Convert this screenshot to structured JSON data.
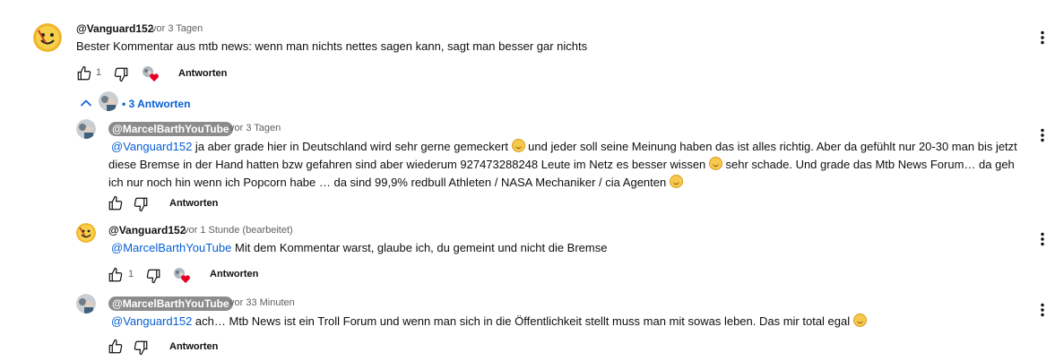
{
  "thread": {
    "main": {
      "author": "@Vanguard152",
      "time": "vor 3 Tagen",
      "text": "Bester Kommentar aus mtb news: wenn man nichts nettes sagen kann, sagt man besser gar nichts",
      "likes": "1",
      "reply_label": "Antworten"
    },
    "replies_toggle": "• 3 Antworten",
    "replies": [
      {
        "author": "@MarcelBarthYouTube",
        "time": "vor 3 Tagen",
        "mention": "@Vanguard152",
        "text_a": " ja aber grade hier in Deutschland wird sehr gerne gemeckert ",
        "text_b": " und jeder soll seine Meinung haben das ist alles richtig. Aber da gefühlt nur 20-30 man bis jetzt diese Bremse in der Hand hatten bzw gefahren sind aber wiederum 927473288248 Leute im Netz es besser wissen ",
        "text_c": " sehr schade. Und grade das Mtb News Forum… da geh ich nur noch hin wenn ich Popcorn habe … da sind 99,9% redbull Athleten / NASA Mechaniker / cia Agenten ",
        "reply_label": "Antworten"
      },
      {
        "author": "@Vanguard152",
        "time": "vor 1 Stunde (bearbeitet)",
        "mention": "@MarcelBarthYouTube",
        "text": " Mit dem Kommentar warst, glaube ich, du gemeint und nicht die Bremse",
        "likes": "1",
        "reply_label": "Antworten"
      },
      {
        "author": "@MarcelBarthYouTube",
        "time": "vor 33 Minuten",
        "mention": "@Vanguard152",
        "text": " ach… Mtb News ist ein Troll Forum und wenn man sich in die Öffentlichkeit stellt muss man mit sowas leben. Das mir total egal ",
        "reply_label": "Antworten"
      }
    ]
  },
  "colors": {
    "link": "#065fd4",
    "chip": "#8c8c8c",
    "heart": "#e60023",
    "text": "#0f0f0f",
    "muted": "#606060"
  },
  "icons": [
    "like-icon",
    "dislike-icon",
    "creator-heart-icon",
    "more-vert-icon",
    "chevron-up-icon",
    "laughing-emoji-icon"
  ]
}
